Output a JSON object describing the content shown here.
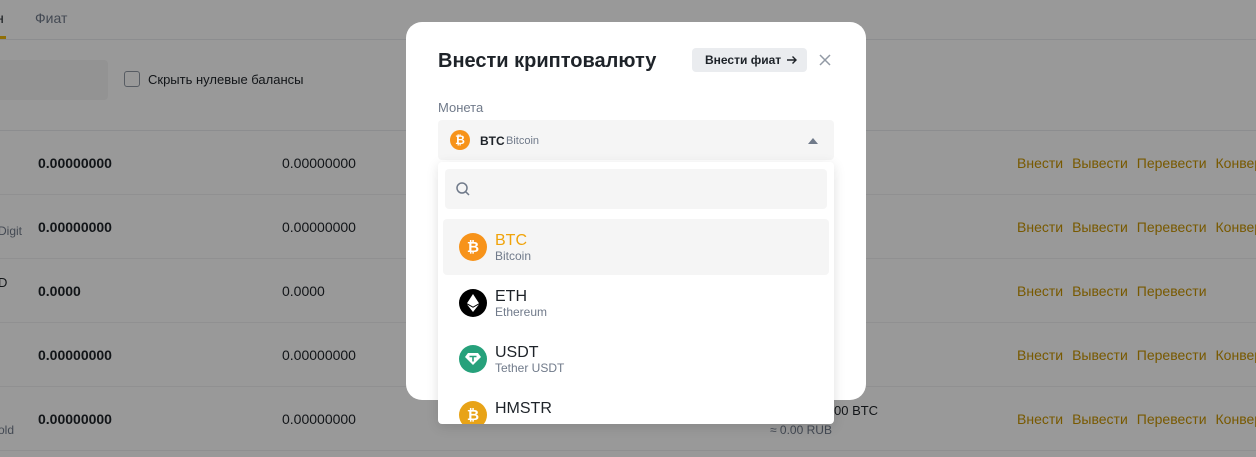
{
  "tabs": {
    "fiat": "Фиат"
  },
  "filters": {
    "hide_zero": "Скрыть нулевые балансы"
  },
  "rows": [
    {
      "name": "",
      "total": "0.00000000",
      "available": "0.00000000",
      "btc_value": "",
      "rub_value": "",
      "actions": [
        "Внести",
        "Вывести",
        "Перевести",
        "Конвер"
      ]
    },
    {
      "name": "Digit",
      "total": "0.00000000",
      "available": "0.00000000",
      "btc_value": "",
      "rub_value": "",
      "actions": [
        "Внести",
        "Вывести",
        "Перевести",
        "Конвер"
      ]
    },
    {
      "name": "D",
      "total": "0.0000",
      "available": "0.0000",
      "btc_value": "",
      "rub_value": "",
      "actions": [
        "Внести",
        "Вывести",
        "Перевести"
      ]
    },
    {
      "name": "",
      "total": "0.00000000",
      "available": "0.00000000",
      "btc_value": "",
      "rub_value": "",
      "actions": [
        "Внести",
        "Вывести",
        "Перевести",
        "Конвер"
      ]
    },
    {
      "name": "old",
      "total": "0.00000000",
      "available": "0.00000000",
      "btc_value": "00 BTC",
      "rub_value": "≈ 0.00 RUB",
      "actions": [
        "Внести",
        "Вывести",
        "Перевести",
        "Конвер"
      ]
    }
  ],
  "modal": {
    "title": "Внести криптовалюту",
    "fiat_button": "Внести фиат",
    "coin_label": "Монета",
    "selected": {
      "symbol": "BTC",
      "name": "Bitcoin",
      "icon": "bitcoin-icon"
    }
  },
  "dropdown": {
    "search_placeholder": "",
    "items": [
      {
        "symbol": "BTC",
        "name": "Bitcoin",
        "icon": "bitcoin-icon",
        "color": "#f7931a",
        "selected": true
      },
      {
        "symbol": "ETH",
        "name": "Ethereum",
        "icon": "ethereum-icon",
        "color": "#000000",
        "selected": false
      },
      {
        "symbol": "USDT",
        "name": "Tether USDT",
        "icon": "tether-icon",
        "color": "#26a17b",
        "selected": false
      },
      {
        "symbol": "HMSTR",
        "name": "",
        "icon": "hamster-icon",
        "color": "#e8a317",
        "selected": false
      }
    ]
  },
  "colors": {
    "accent": "#f0b90b",
    "action_link": "#c99400",
    "selected_text": "#f0a30a"
  }
}
